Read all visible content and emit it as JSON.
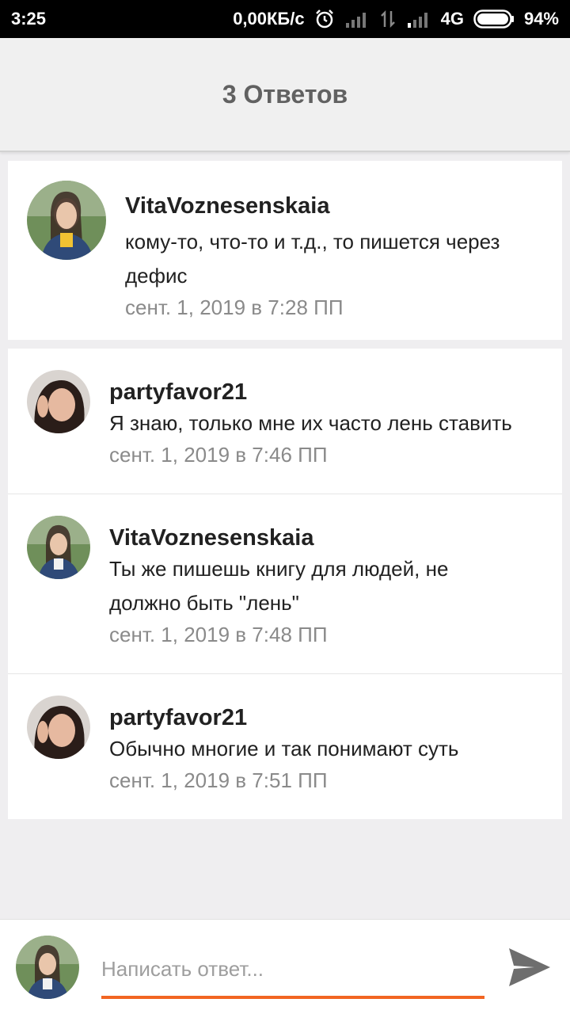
{
  "status_bar": {
    "time": "3:25",
    "network_speed": "0,00КБ/с",
    "network_type": "4G",
    "battery": "94%",
    "icons": [
      "alarm-icon",
      "signal-icon",
      "data-transfer-icon",
      "signal-icon",
      "battery-icon"
    ]
  },
  "header": {
    "title": "3 Ответов"
  },
  "main_comment": {
    "username": "VitaVoznesenskaia",
    "text": "кому-то, что-то и т.д., то пишется через дефис",
    "date": "сент. 1, 2019 в 7:28 ПП"
  },
  "replies": [
    {
      "username": "partyfavor21",
      "text": "Я знаю, только мне их часто лень ставить",
      "date": "сент. 1, 2019 в 7:46 ПП"
    },
    {
      "username": "VitaVoznesenskaia",
      "text": "Ты же пишешь книгу для людей, не должно быть \"лень\"",
      "date": "сент. 1, 2019 в 7:48 ПП"
    },
    {
      "username": "partyfavor21",
      "text": "Обычно многие и так понимают суть",
      "date": "сент. 1, 2019 в 7:51 ПП"
    }
  ],
  "reply_bar": {
    "placeholder": "Написать ответ...",
    "value": "",
    "accent_color": "#f26522"
  },
  "colors": {
    "accent": "#f26522",
    "header_text": "#616161",
    "background": "#efeef0"
  }
}
